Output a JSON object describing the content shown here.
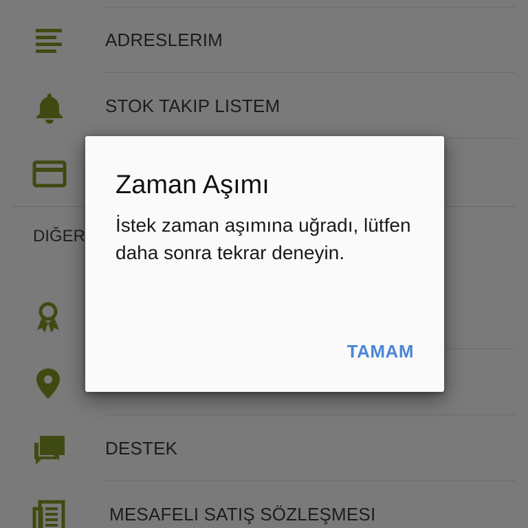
{
  "menu": {
    "items": [
      {
        "label": "ADRESLERIM",
        "icon": "list-icon"
      },
      {
        "label": "STOK TAKIP LISTEM",
        "icon": "bell-icon"
      },
      {
        "label": "",
        "icon": "credit-card-icon"
      }
    ],
    "section_header": "DIĞER",
    "other_items": [
      {
        "label": "",
        "icon": "award-icon"
      },
      {
        "label": "",
        "icon": "location-pin-icon"
      },
      {
        "label": "DESTEK",
        "icon": "chat-icon"
      },
      {
        "label": "MESAFELI SATIŞ SÖZLEŞMESI",
        "icon": "document-icon"
      }
    ]
  },
  "dialog": {
    "title": "Zaman Aşımı",
    "message": "İstek zaman aşımına uğradı, lütfen daha sonra tekrar deneyin.",
    "ok_label": "TAMAM"
  },
  "colors": {
    "icon": "#3f4a12",
    "background_dimmed": "#7a7a7a",
    "dialog_background": "#fafafa",
    "accent": "#4a86d6"
  }
}
